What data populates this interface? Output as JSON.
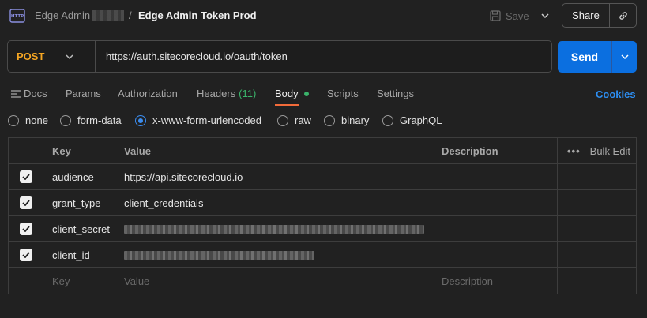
{
  "header": {
    "icon": "http-icon",
    "workspace": "Edge Admin",
    "separator": "/",
    "title": "Edge Admin Token Prod",
    "save_label": "Save",
    "share_label": "Share"
  },
  "request": {
    "method": "POST",
    "url": "https://auth.sitecorecloud.io/oauth/token",
    "send_label": "Send"
  },
  "tabs": {
    "docs": "Docs",
    "params": "Params",
    "authorization": "Authorization",
    "headers": "Headers",
    "headers_count": "(11)",
    "body": "Body",
    "scripts": "Scripts",
    "settings": "Settings",
    "cookies": "Cookies"
  },
  "body_types": {
    "none": "none",
    "form_data": "form-data",
    "urlencoded": "x-www-form-urlencoded",
    "raw": "raw",
    "binary": "binary",
    "graphql": "GraphQL",
    "selected": "x-www-form-urlencoded"
  },
  "table": {
    "headers": {
      "key": "Key",
      "value": "Value",
      "description": "Description",
      "bulk_edit": "Bulk Edit"
    },
    "rows": [
      {
        "key": "audience",
        "value": "https://api.sitecorecloud.io",
        "checked": true
      },
      {
        "key": "grant_type",
        "value": "client_credentials",
        "checked": true
      },
      {
        "key": "client_secret",
        "value": "",
        "checked": true
      },
      {
        "key": "client_id",
        "value": "",
        "checked": true
      }
    ],
    "placeholders": {
      "key": "Key",
      "value": "Value",
      "description": "Description"
    }
  },
  "colors": {
    "method": "#f5a623",
    "send": "#0b6fe0",
    "cookies": "#2d8ef2",
    "active_tab_underline": "#f26b3a",
    "status_green": "#3ab36a",
    "radio_selected": "#3b8df0"
  }
}
